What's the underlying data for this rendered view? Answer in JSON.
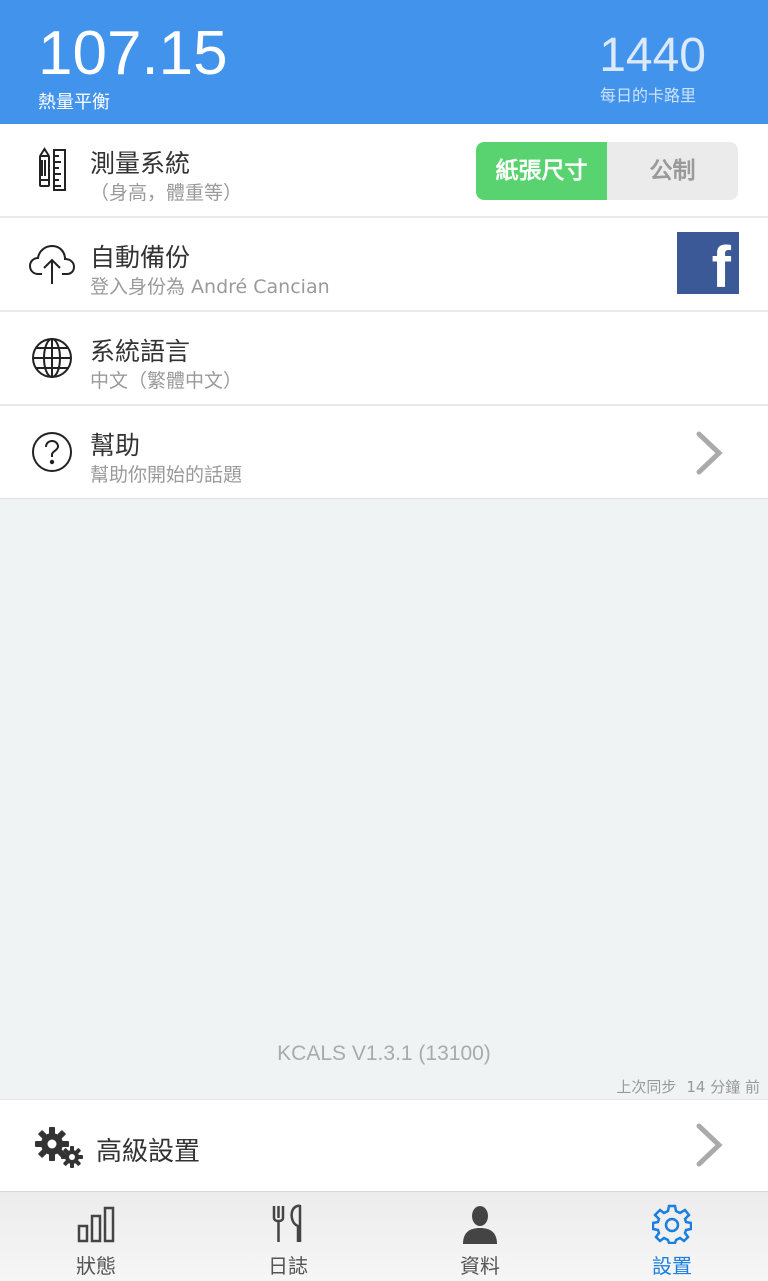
{
  "header": {
    "balance_value": "107.15",
    "balance_label": "熱量平衡",
    "daily_value": "1440",
    "daily_label": "每日的卡路里"
  },
  "settings": {
    "measurement": {
      "title": "測量系統",
      "subtitle": "（身高，體重等）",
      "option_imperial": "紙張尺寸",
      "option_metric": "公制",
      "selected": "紙張尺寸"
    },
    "backup": {
      "title": "自動備份",
      "subtitle": "登入身份為 André Cancian",
      "facebook_glyph": "f"
    },
    "language": {
      "title": "系統語言",
      "subtitle": "中文（繁體中文）"
    },
    "help": {
      "title": "幫助",
      "subtitle": "幫助你開始的話題"
    }
  },
  "footer": {
    "version": "KCALS V1.3.1 (13100)",
    "sync_label": "上次同步",
    "sync_time": "14 分鐘 前"
  },
  "advanced": {
    "title": "高級設置"
  },
  "nav": {
    "items": [
      {
        "label": "狀態",
        "icon": "bar-chart-icon"
      },
      {
        "label": "日誌",
        "icon": "utensils-icon"
      },
      {
        "label": "資料",
        "icon": "person-icon"
      },
      {
        "label": "設置",
        "icon": "gear-icon",
        "active": true
      }
    ]
  },
  "colors": {
    "header_bg": "#4293ec",
    "toggle_active": "#58d36f",
    "facebook": "#3b5997",
    "nav_active": "#1a7fe0"
  }
}
